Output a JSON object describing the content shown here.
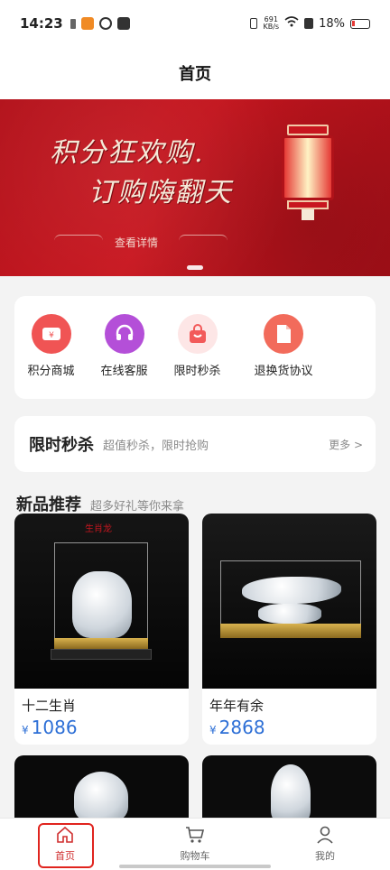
{
  "status": {
    "time": "14:23",
    "net_speed": "691",
    "net_unit": "KB/s",
    "battery": "18%"
  },
  "header": {
    "title": "首页"
  },
  "banner": {
    "line1": "积分狂欢购.",
    "line2": "订购嗨翻天",
    "detail": "查看详情"
  },
  "quick": [
    {
      "label": "积分商城",
      "icon": "points-ticket-icon",
      "color": "#f05454"
    },
    {
      "label": "在线客服",
      "icon": "headset-icon",
      "color": "#b44fd8"
    },
    {
      "label": "限时秒杀",
      "icon": "shopping-bag-icon",
      "color": "#f25a5a"
    },
    {
      "label": "退换货协议",
      "icon": "document-icon",
      "color": "#f26b5b"
    }
  ],
  "flash_sale": {
    "title": "限时秒杀",
    "subtitle": "超值秒杀，限时抢购",
    "more": "更多 >"
  },
  "new_products": {
    "title": "新品推荐",
    "subtitle": "超多好礼等你来拿",
    "items": [
      {
        "name": "十二生肖",
        "currency": "¥",
        "price": "1086",
        "label": "生肖龙"
      },
      {
        "name": "年年有余",
        "currency": "¥",
        "price": "2868"
      }
    ]
  },
  "nav": [
    {
      "label": "首页",
      "icon": "home-icon"
    },
    {
      "label": "购物车",
      "icon": "cart-icon"
    },
    {
      "label": "我的",
      "icon": "user-icon"
    }
  ],
  "colors": {
    "accent": "#d02f2f",
    "price": "#2d6fd6"
  }
}
